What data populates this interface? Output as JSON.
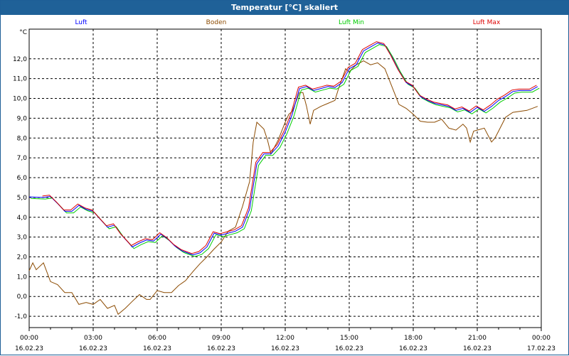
{
  "window_title": "Temperatur [°C] skaliert",
  "chart_data": {
    "type": "line",
    "title": "Temperatur [°C] skaliert",
    "ylabel": "°C",
    "xlabel": "",
    "xlim": [
      0,
      24
    ],
    "ylim": [
      -1.57,
      13.5
    ],
    "grid": true,
    "legend": "top",
    "yticks": [
      -1,
      0,
      1,
      2,
      3,
      4,
      5,
      6,
      7,
      8,
      9,
      10,
      11,
      12
    ],
    "ytick_labels": [
      "-1,0",
      "0,0",
      "1,0",
      "2,0",
      "3,0",
      "4,0",
      "5,0",
      "6,0",
      "7,0",
      "8,0",
      "9,0",
      "10,0",
      "11,0",
      "12,0"
    ],
    "xticks": [
      0,
      3,
      6,
      9,
      12,
      15,
      18,
      21,
      24
    ],
    "xtick_labels": [
      [
        "00:00",
        "16.02.23"
      ],
      [
        "03:00",
        "16.02.23"
      ],
      [
        "06:00",
        "16.02.23"
      ],
      [
        "09:00",
        "16.02.23"
      ],
      [
        "12:00",
        "16.02.23"
      ],
      [
        "15:00",
        "16.02.23"
      ],
      [
        "18:00",
        "16.02.23"
      ],
      [
        "21:00",
        "16.02.23"
      ],
      [
        "00:00",
        "17.02.23"
      ]
    ],
    "series": [
      {
        "name": "Luft",
        "color": "#0000ff",
        "points": [
          [
            0,
            5.03
          ],
          [
            0.67,
            5.0
          ],
          [
            1,
            5.05
          ],
          [
            1.33,
            4.7
          ],
          [
            1.67,
            4.3
          ],
          [
            2,
            4.3
          ],
          [
            2.33,
            4.6
          ],
          [
            2.67,
            4.4
          ],
          [
            3,
            4.3
          ],
          [
            3.33,
            3.9
          ],
          [
            3.67,
            3.5
          ],
          [
            4,
            3.6
          ],
          [
            4.33,
            3.1
          ],
          [
            4.67,
            2.7
          ],
          [
            4.83,
            2.5
          ],
          [
            5.17,
            2.7
          ],
          [
            5.5,
            2.85
          ],
          [
            5.83,
            2.8
          ],
          [
            6.17,
            3.15
          ],
          [
            6.5,
            2.9
          ],
          [
            6.83,
            2.55
          ],
          [
            7.17,
            2.3
          ],
          [
            7.67,
            2.1
          ],
          [
            8,
            2.2
          ],
          [
            8.33,
            2.5
          ],
          [
            8.67,
            3.2
          ],
          [
            9,
            3.1
          ],
          [
            9.33,
            3.2
          ],
          [
            9.67,
            3.3
          ],
          [
            10,
            3.5
          ],
          [
            10.33,
            4.4
          ],
          [
            10.67,
            6.7
          ],
          [
            11,
            7.2
          ],
          [
            11.33,
            7.2
          ],
          [
            11.67,
            7.6
          ],
          [
            12,
            8.3
          ],
          [
            12.33,
            9.2
          ],
          [
            12.67,
            10.5
          ],
          [
            13,
            10.6
          ],
          [
            13.33,
            10.4
          ],
          [
            13.67,
            10.5
          ],
          [
            14,
            10.6
          ],
          [
            14.33,
            10.55
          ],
          [
            14.67,
            10.8
          ],
          [
            15,
            11.5
          ],
          [
            15.33,
            11.7
          ],
          [
            15.67,
            12.4
          ],
          [
            16,
            12.6
          ],
          [
            16.33,
            12.8
          ],
          [
            16.67,
            12.7
          ],
          [
            17,
            12.1
          ],
          [
            17.33,
            11.4
          ],
          [
            17.67,
            10.8
          ],
          [
            18,
            10.6
          ],
          [
            18.33,
            10.1
          ],
          [
            18.67,
            9.9
          ],
          [
            19,
            9.75
          ],
          [
            19.67,
            9.6
          ],
          [
            20,
            9.4
          ],
          [
            20.33,
            9.5
          ],
          [
            20.67,
            9.3
          ],
          [
            21,
            9.55
          ],
          [
            21.33,
            9.35
          ],
          [
            21.67,
            9.6
          ],
          [
            22,
            9.9
          ],
          [
            22.33,
            10.1
          ],
          [
            22.67,
            10.35
          ],
          [
            23,
            10.4
          ],
          [
            23.5,
            10.4
          ],
          [
            23.83,
            10.6
          ]
        ]
      },
      {
        "name": "Boden",
        "color": "#8b4a00",
        "points": [
          [
            0,
            1.3
          ],
          [
            0.17,
            1.7
          ],
          [
            0.33,
            1.35
          ],
          [
            0.67,
            1.7
          ],
          [
            1,
            0.75
          ],
          [
            1.33,
            0.6
          ],
          [
            1.67,
            0.2
          ],
          [
            2,
            0.2
          ],
          [
            2.33,
            -0.4
          ],
          [
            2.67,
            -0.3
          ],
          [
            3,
            -0.4
          ],
          [
            3.33,
            -0.15
          ],
          [
            3.67,
            -0.6
          ],
          [
            4,
            -0.45
          ],
          [
            4.17,
            -0.9
          ],
          [
            4.5,
            -0.6
          ],
          [
            4.83,
            -0.25
          ],
          [
            5.17,
            0.1
          ],
          [
            5.5,
            -0.15
          ],
          [
            5.67,
            -0.15
          ],
          [
            6,
            0.3
          ],
          [
            6.33,
            0.2
          ],
          [
            6.67,
            0.2
          ],
          [
            7,
            0.55
          ],
          [
            7.33,
            0.8
          ],
          [
            7.67,
            1.25
          ],
          [
            8,
            1.65
          ],
          [
            8.33,
            2.0
          ],
          [
            8.67,
            2.4
          ],
          [
            9,
            2.75
          ],
          [
            9.33,
            3.3
          ],
          [
            9.67,
            3.5
          ],
          [
            10,
            4.55
          ],
          [
            10.33,
            5.8
          ],
          [
            10.5,
            7.8
          ],
          [
            10.67,
            8.8
          ],
          [
            11,
            8.45
          ],
          [
            11.17,
            7.9
          ],
          [
            11.33,
            7.2
          ],
          [
            11.67,
            7.9
          ],
          [
            12,
            8.8
          ],
          [
            12.17,
            9.2
          ],
          [
            12.33,
            9.35
          ],
          [
            12.67,
            10.3
          ],
          [
            12.83,
            10.3
          ],
          [
            13,
            9.6
          ],
          [
            13.17,
            8.7
          ],
          [
            13.33,
            9.4
          ],
          [
            13.67,
            9.6
          ],
          [
            14,
            9.75
          ],
          [
            14.33,
            9.9
          ],
          [
            14.5,
            10.5
          ],
          [
            14.67,
            11.0
          ],
          [
            14.83,
            11.5
          ],
          [
            15,
            11.35
          ],
          [
            15.33,
            11.7
          ],
          [
            15.67,
            11.9
          ],
          [
            16,
            11.7
          ],
          [
            16.33,
            11.8
          ],
          [
            16.67,
            11.5
          ],
          [
            17,
            10.6
          ],
          [
            17.33,
            9.7
          ],
          [
            17.67,
            9.5
          ],
          [
            18,
            9.2
          ],
          [
            18.33,
            8.85
          ],
          [
            18.67,
            8.8
          ],
          [
            19,
            8.8
          ],
          [
            19.33,
            8.95
          ],
          [
            19.67,
            8.5
          ],
          [
            20,
            8.4
          ],
          [
            20.33,
            8.7
          ],
          [
            20.5,
            8.5
          ],
          [
            20.67,
            7.8
          ],
          [
            20.83,
            8.35
          ],
          [
            21,
            8.4
          ],
          [
            21.33,
            8.5
          ],
          [
            21.67,
            7.8
          ],
          [
            21.83,
            8.0
          ],
          [
            22,
            8.35
          ],
          [
            22.33,
            9.05
          ],
          [
            22.67,
            9.3
          ],
          [
            23.33,
            9.4
          ],
          [
            23.83,
            9.6
          ]
        ]
      },
      {
        "name": "Luft Min",
        "color": "#00cc00",
        "offset_hours": 0.08,
        "offset_value": -0.08
      },
      {
        "name": "Luft Max",
        "color": "#dd0000",
        "offset_hours": -0.05,
        "offset_value": 0.07
      }
    ]
  }
}
